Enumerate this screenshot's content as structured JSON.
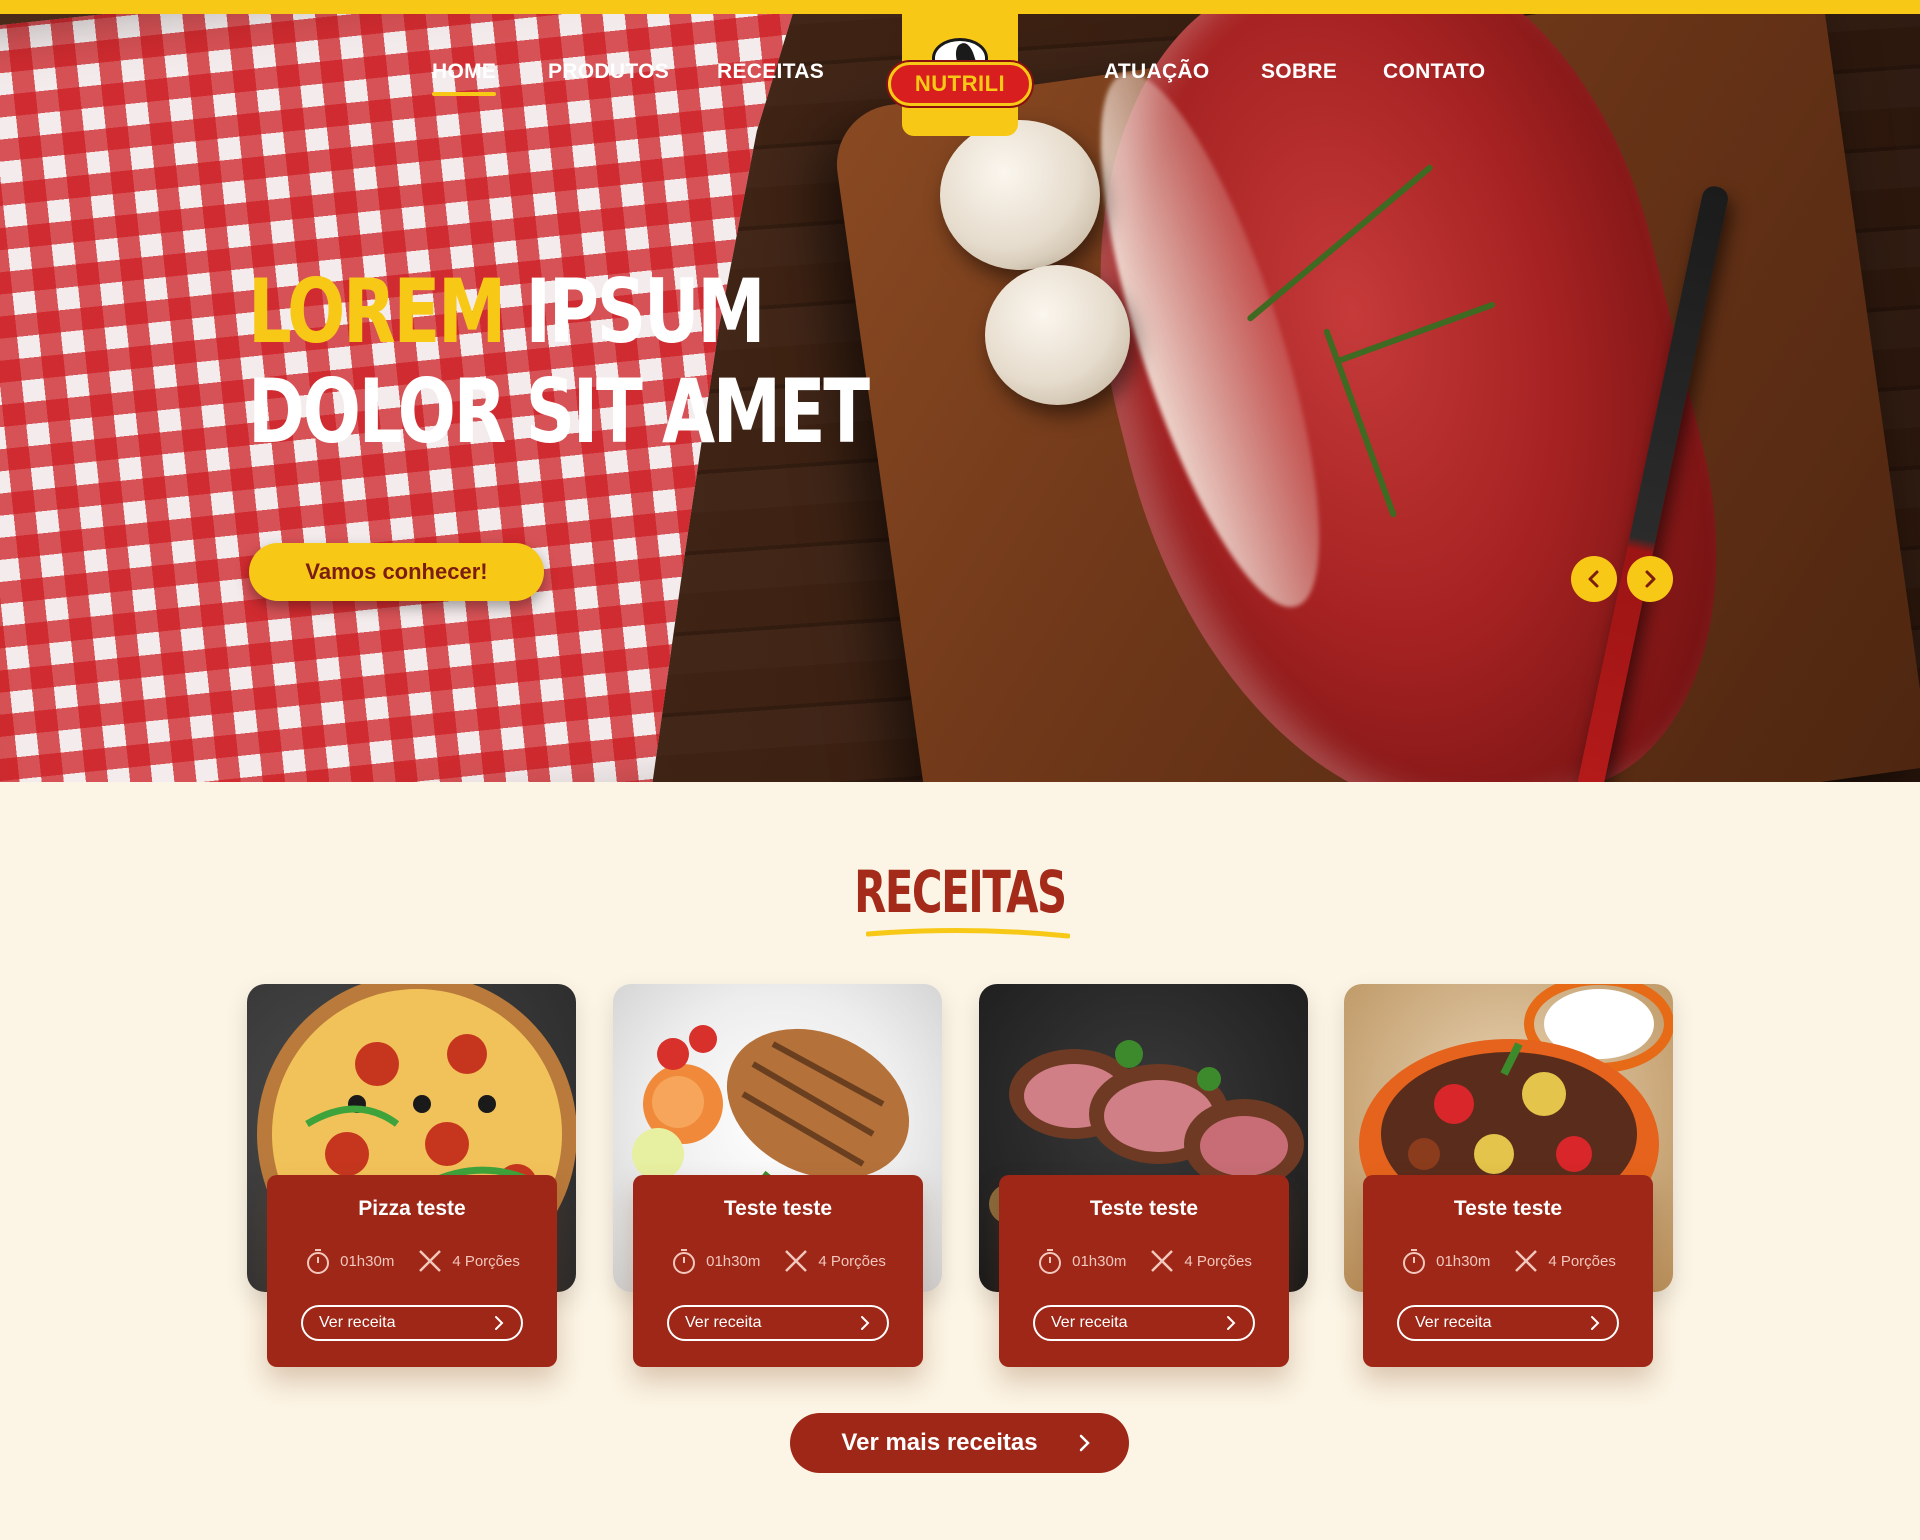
{
  "brand": {
    "name": "NUTRILI"
  },
  "nav": {
    "left": [
      {
        "label": "HOME",
        "active": true
      },
      {
        "label": "PRODUTOS",
        "active": false
      },
      {
        "label": "RECEITAS",
        "active": false
      }
    ],
    "right": [
      {
        "label": "ATUAÇÃO"
      },
      {
        "label": "SOBRE"
      },
      {
        "label": "CONTATO"
      }
    ]
  },
  "hero": {
    "headline_word1": "LOREM",
    "headline_rest1": " IPSUM",
    "headline_line2": "DOLOR SIT AMET",
    "cta_label": "Vamos conhecer!",
    "prev_icon": "chevron-left-icon",
    "next_icon": "chevron-right-icon"
  },
  "recipes": {
    "section_title": "RECEITAS",
    "items": [
      {
        "title": "Pizza teste",
        "time": "01h30m",
        "servings": "4 Porções",
        "button": "Ver receita"
      },
      {
        "title": "Teste teste",
        "time": "01h30m",
        "servings": "4 Porções",
        "button": "Ver receita"
      },
      {
        "title": "Teste teste",
        "time": "01h30m",
        "servings": "4 Porções",
        "button": "Ver receita"
      },
      {
        "title": "Teste teste",
        "time": "01h30m",
        "servings": "4 Porções",
        "button": "Ver receita"
      }
    ],
    "more_button": "Ver mais receitas"
  },
  "colors": {
    "yellow": "#f7c916",
    "dark_red": "#9e2717",
    "title_red": "#a42a1a",
    "cream": "#fcf4e4"
  }
}
